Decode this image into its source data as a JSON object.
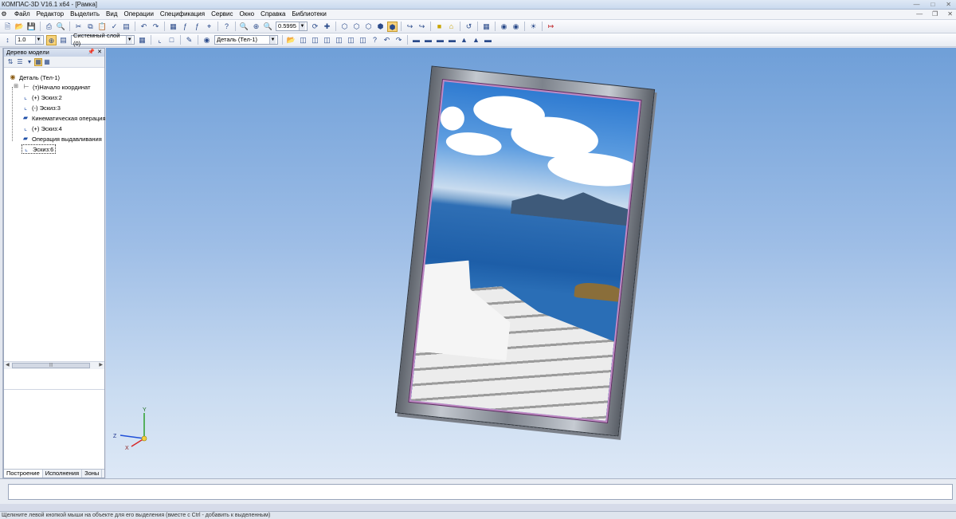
{
  "window": {
    "title": "КОМПАС-3D V16.1 x64 - [Рамка]"
  },
  "menu": {
    "items": [
      "Файл",
      "Редактор",
      "Выделить",
      "Вид",
      "Операции",
      "Спецификация",
      "Сервис",
      "Окно",
      "Справка",
      "Библиотеки"
    ]
  },
  "toolbar": {
    "zoom_value": "0.5995",
    "step_value": "1.0",
    "layer_value": "Системный слой (0)",
    "detail_value": "Деталь (Тел-1)"
  },
  "tree_panel": {
    "title": "Дерево модели",
    "items": [
      {
        "label": "Деталь (Тел-1)",
        "icon": "part-icon"
      },
      {
        "label": "(т)Начало координат",
        "icon": "origin-icon"
      },
      {
        "label": "(+) Эскиз:2",
        "icon": "sketch-icon"
      },
      {
        "label": "(-) Эскиз:3",
        "icon": "sketch-icon"
      },
      {
        "label": "Кинематическая операция",
        "icon": "sweep-icon"
      },
      {
        "label": "(+) Эскиз:4",
        "icon": "sketch-icon"
      },
      {
        "label": "Операция выдавливания",
        "icon": "extrude-icon"
      },
      {
        "label": "Эскиз:6",
        "icon": "sketch-icon"
      }
    ],
    "tabs": [
      "Построение",
      "Исполнения",
      "Зоны"
    ]
  },
  "status": {
    "hint": "Щелкните левой кнопкой мыши на объекте для его выделения (вместе с Ctrl - добавить к выделенным)"
  },
  "axes": {
    "labels": [
      "Y",
      "Z",
      "X"
    ],
    "colors": {
      "y": "#2ca02c",
      "z": "#1f4fd8",
      "x": "#d62728"
    }
  }
}
